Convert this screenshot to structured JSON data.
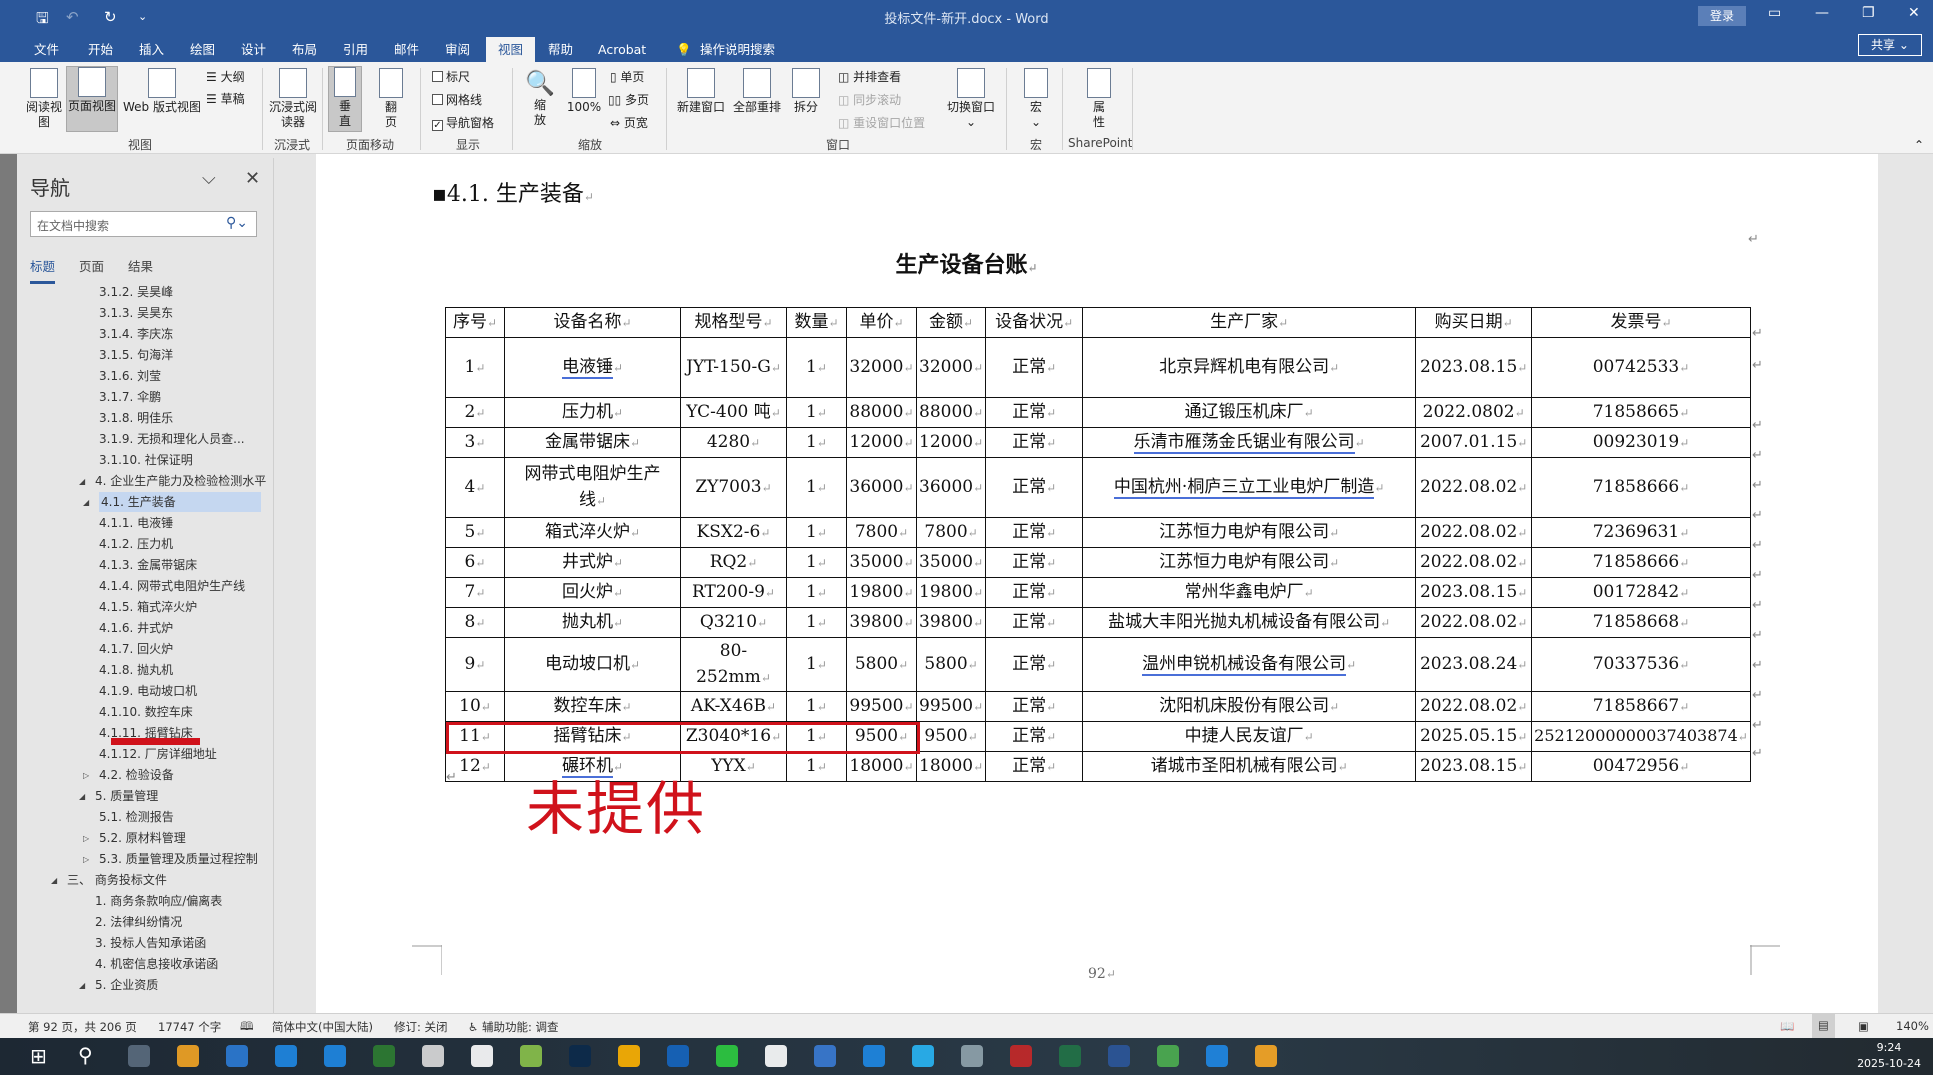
{
  "titlebar": {
    "title": "投标文件-新开.docx  -  Word",
    "login": "登录",
    "share": "共享"
  },
  "menu_tabs": [
    "文件",
    "开始",
    "插入",
    "绘图",
    "设计",
    "布局",
    "引用",
    "邮件",
    "审阅",
    "视图",
    "帮助",
    "Acrobat"
  ],
  "tell_me": "操作说明搜索",
  "ribbon": {
    "view": {
      "read": "阅读视图",
      "print": "页面视图",
      "web": "Web 版式视图",
      "outline": "大纲",
      "draft": "草稿",
      "group": "视图"
    },
    "immersive": {
      "reader": "沉浸式阅读器",
      "group": "沉浸式"
    },
    "page_move": {
      "vertical": "垂直",
      "side": "翻页",
      "group": "页面移动"
    },
    "show": {
      "ruler": "标尺",
      "gridlines": "网格线",
      "nav_pane": "导航窗格",
      "group": "显示",
      "ruler_checked": false,
      "gridlines_checked": false,
      "nav_checked": true
    },
    "zoom": {
      "zoom": "缩放",
      "hundred": "100%",
      "one_page": "单页",
      "multi_page": "多页",
      "page_width": "页宽",
      "group": "缩放"
    },
    "window": {
      "new": "新建窗口",
      "arrange": "全部重排",
      "split": "拆分",
      "side_by_side": "并排查看",
      "sync_scroll": "同步滚动",
      "reset_pos": "重设窗口位置",
      "switch": "切换窗口",
      "group": "窗口"
    },
    "macros": {
      "macro": "宏",
      "group": "宏"
    },
    "sharepoint": {
      "props": "属性",
      "group": "SharePoint"
    }
  },
  "nav": {
    "title": "导航",
    "search_placeholder": "在文档中搜索",
    "tabs": [
      "标题",
      "页面",
      "结果"
    ],
    "items": [
      {
        "label": "3.1.2. 吴昊峰"
      },
      {
        "label": "3.1.3. 吴昊东"
      },
      {
        "label": "3.1.4. 李庆冻"
      },
      {
        "label": "3.1.5. 句海洋"
      },
      {
        "label": "3.1.6. 刘莹"
      },
      {
        "label": "3.1.7. 伞鹏"
      },
      {
        "label": "3.1.8. 明佳乐"
      },
      {
        "label": "3.1.9. 无损和理化人员查..."
      },
      {
        "label": "3.1.10. 社保证明"
      },
      {
        "label": "4. 企业生产能力及检验检测水平"
      },
      {
        "label": "4.1. 生产装备"
      },
      {
        "label": "4.1.1. 电液锤"
      },
      {
        "label": "4.1.2. 压力机"
      },
      {
        "label": "4.1.3. 金属带锯床"
      },
      {
        "label": "4.1.4. 网带式电阻炉生产线"
      },
      {
        "label": "4.1.5. 箱式淬火炉"
      },
      {
        "label": "4.1.6. 井式炉"
      },
      {
        "label": "4.1.7. 回火炉"
      },
      {
        "label": "4.1.8. 抛丸机"
      },
      {
        "label": "4.1.9. 电动坡口机"
      },
      {
        "label": "4.1.10. 数控车床"
      },
      {
        "label": "4.1.11. 摇臂钻床"
      },
      {
        "label": "4.1.12. 厂房详细地址"
      },
      {
        "label": "4.2. 检验设备"
      },
      {
        "label": "5. 质量管理"
      },
      {
        "label": "5.1. 检测报告"
      },
      {
        "label": "5.2. 原材料管理"
      },
      {
        "label": "5.3. 质量管理及质量过程控制"
      },
      {
        "label": "三、  商务投标文件"
      },
      {
        "label": "1. 商务条款响应/偏离表"
      },
      {
        "label": "2. 法律纠纷情况"
      },
      {
        "label": "3. 投标人告知承诺函"
      },
      {
        "label": "4. 机密信息接收承诺函"
      },
      {
        "label": "5. 企业资质"
      }
    ]
  },
  "doc": {
    "heading": "4.1. 生产装备",
    "table_title": "生产设备台账",
    "annotation": "未提供",
    "page_number": "92",
    "table": {
      "headers": [
        "序号",
        "设备名称",
        "规格型号",
        "数量",
        "单价",
        "金额",
        "设备状况",
        "生产厂家",
        "购买日期",
        "发票号"
      ],
      "rows": [
        [
          "1",
          "电液锤",
          "JYT-150-G",
          "1",
          "32000",
          "32000",
          "正常",
          "北京异辉机电有限公司",
          "2023.08.15",
          "00742533"
        ],
        [
          "2",
          "压力机",
          "YC-400 吨",
          "1",
          "88000",
          "88000",
          "正常",
          "通辽锻压机床厂",
          "2022.0802",
          "71858665"
        ],
        [
          "3",
          "金属带锯床",
          "4280",
          "1",
          "12000",
          "12000",
          "正常",
          "乐清市雁荡金氏锯业有限公司",
          "2007.01.15",
          "00923019"
        ],
        [
          "4",
          "网带式电阻炉生产线",
          "ZY7003",
          "1",
          "36000",
          "36000",
          "正常",
          "中国杭州·桐庐三立工业电炉厂制造",
          "2022.08.02",
          "71858666"
        ],
        [
          "5",
          "箱式淬火炉",
          "KSX2-6",
          "1",
          "7800",
          "7800",
          "正常",
          "江苏恒力电炉有限公司",
          "2022.08.02",
          "72369631"
        ],
        [
          "6",
          "井式炉",
          "RQ2",
          "1",
          "35000",
          "35000",
          "正常",
          "江苏恒力电炉有限公司",
          "2022.08.02",
          "71858666"
        ],
        [
          "7",
          "回火炉",
          "RT200-9",
          "1",
          "19800",
          "19800",
          "正常",
          "常州华鑫电炉厂",
          "2023.08.15",
          "00172842"
        ],
        [
          "8",
          "抛丸机",
          "Q3210",
          "1",
          "39800",
          "39800",
          "正常",
          "盐城大丰阳光抛丸机械设备有限公司",
          "2022.08.02",
          "71858668"
        ],
        [
          "9",
          "电动坡口机",
          "80-252mm",
          "1",
          "5800",
          "5800",
          "正常",
          "温州申锐机械设备有限公司",
          "2023.08.24",
          "70337536"
        ],
        [
          "10",
          "数控车床",
          "AK-X46B",
          "1",
          "99500",
          "99500",
          "正常",
          "沈阳机床股份有限公司",
          "2022.08.02",
          "71858667"
        ],
        [
          "11",
          "摇臂钻床",
          "Z3040*16",
          "1",
          "9500",
          "9500",
          "正常",
          "中捷人民友谊厂",
          "2025.05.15",
          "25212000000037403874"
        ],
        [
          "12",
          "碾环机",
          "YYX",
          "1",
          "18000",
          "18000",
          "正常",
          "诸城市圣阳机械有限公司",
          "2023.08.15",
          "00472956"
        ]
      ]
    }
  },
  "status": {
    "page": "第 92 页，共 206 页",
    "words": "17747 个字",
    "language": "简体中文(中国大陆)",
    "track": "修订: 关闭",
    "accessibility": "辅助功能: 调查",
    "zoom": "140%"
  },
  "clock": {
    "time": "9:24",
    "date": "2025-10-24"
  },
  "colors": {
    "brand": "#2b579a",
    "annotation_red": "#d0121b"
  }
}
